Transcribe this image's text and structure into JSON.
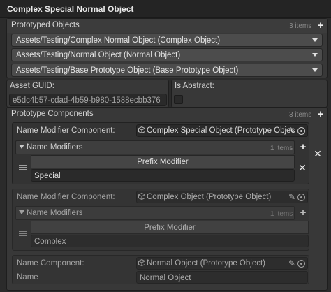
{
  "title": "Complex Special Normal Object",
  "prototyped_objects": {
    "label": "Prototyped Objects",
    "count": "3 items",
    "items": [
      "Assets/Testing/Complex Normal Object (Complex Object)",
      "Assets/Testing/Normal Object (Normal Object)",
      "Assets/Testing/Base Prototype Object (Base Prototype Object)"
    ]
  },
  "asset_guid": {
    "label": "Asset GUID:",
    "value": "e5dc4b57-cdad-4b59-b980-1588ecbb376"
  },
  "is_abstract": {
    "label": "Is Abstract:"
  },
  "prototype_components": {
    "label": "Prototype Components",
    "count": "3 items",
    "components": [
      {
        "label": "Name Modifier Component:",
        "value": "Complex Special Object (Prototype Objec",
        "modifiers_label": "Name Modifiers",
        "modifiers_count": "1 items",
        "modifier_title": "Prefix Modifier",
        "modifier_value": "Special"
      },
      {
        "label": "Name Modifier Component:",
        "value": "Complex Object (Prototype Object)",
        "modifiers_label": "Name Modifiers",
        "modifiers_count": "1 items",
        "modifier_title": "Prefix Modifier",
        "modifier_value": "Complex"
      },
      {
        "label": "Name Component:",
        "value": "Normal Object (Prototype Object)",
        "name_label": "Name",
        "name_value": "Normal Object"
      }
    ]
  },
  "icons": {
    "add": "+",
    "remove": "✕",
    "edit": "✎"
  },
  "colors": {
    "background": "#2b2b2b",
    "panel": "#383838",
    "field": "#2a2a2a"
  }
}
